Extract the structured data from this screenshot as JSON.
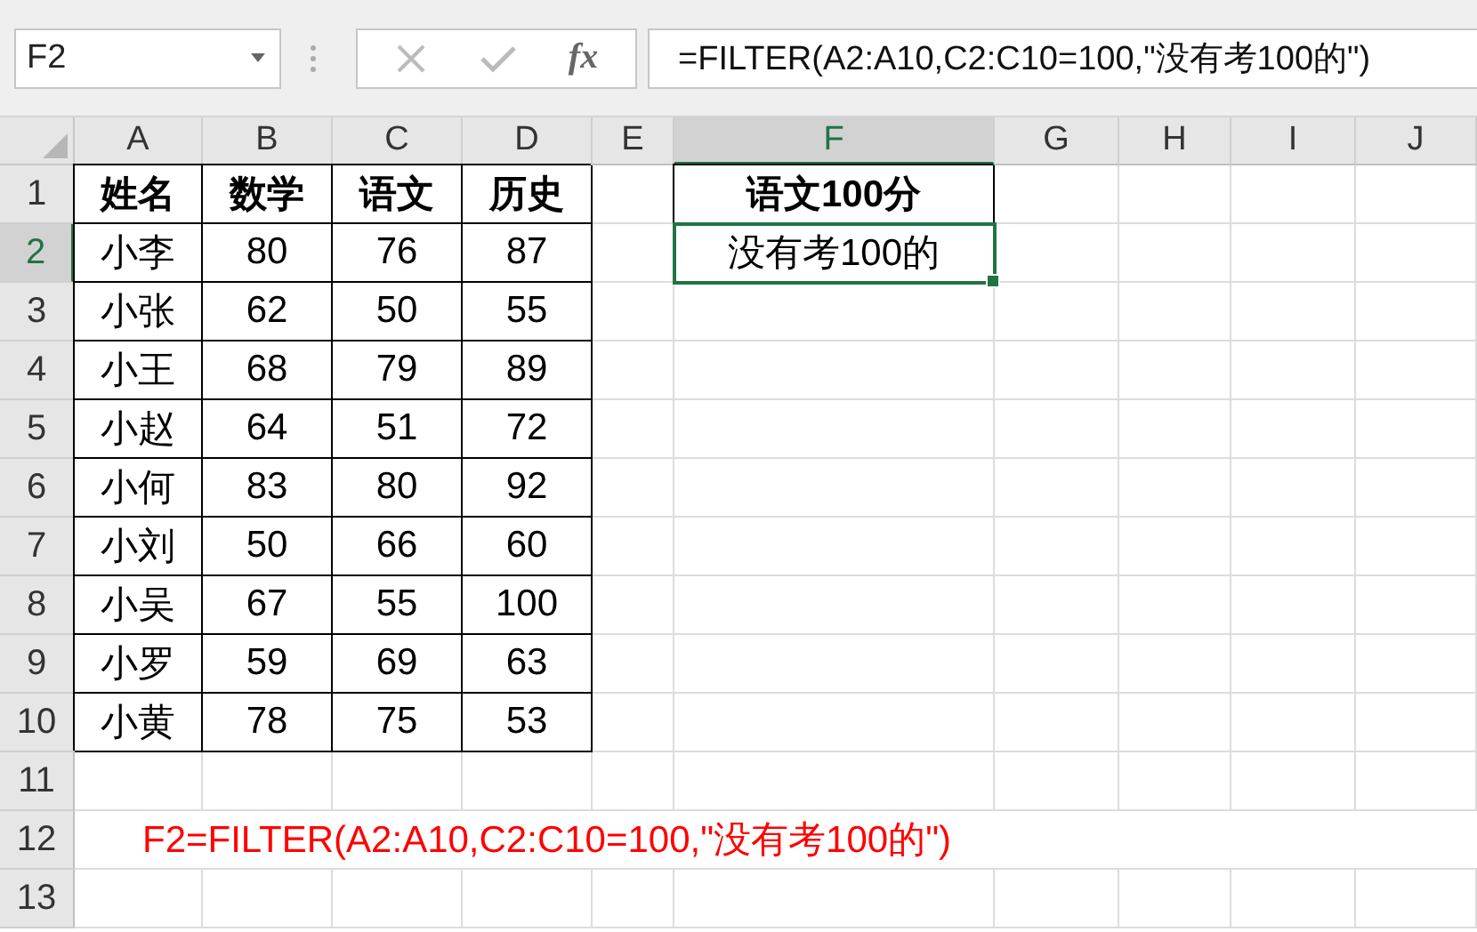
{
  "name_box": {
    "value": "F2"
  },
  "formula_bar": {
    "function_label": "fx",
    "value": "=FILTER(A2:A10,C2:C10=100,\"没有考100的\")"
  },
  "columns": [
    {
      "label": "A",
      "selected": false
    },
    {
      "label": "B",
      "selected": false
    },
    {
      "label": "C",
      "selected": false
    },
    {
      "label": "D",
      "selected": false
    },
    {
      "label": "E",
      "selected": false
    },
    {
      "label": "F",
      "selected": true
    },
    {
      "label": "G",
      "selected": false
    },
    {
      "label": "H",
      "selected": false
    },
    {
      "label": "I",
      "selected": false
    },
    {
      "label": "J",
      "selected": false
    }
  ],
  "row_headers": [
    {
      "label": "1",
      "selected": false
    },
    {
      "label": "2",
      "selected": true
    },
    {
      "label": "3",
      "selected": false
    },
    {
      "label": "4",
      "selected": false
    },
    {
      "label": "5",
      "selected": false
    },
    {
      "label": "6",
      "selected": false
    },
    {
      "label": "7",
      "selected": false
    },
    {
      "label": "8",
      "selected": false
    },
    {
      "label": "9",
      "selected": false
    },
    {
      "label": "10",
      "selected": false
    },
    {
      "label": "11",
      "selected": false
    },
    {
      "label": "12",
      "selected": false
    },
    {
      "label": "13",
      "selected": false
    }
  ],
  "score_table": {
    "header": [
      "姓名",
      "数学",
      "语文",
      "历史"
    ],
    "rows": [
      [
        "小李",
        "80",
        "76",
        "87"
      ],
      [
        "小张",
        "62",
        "50",
        "55"
      ],
      [
        "小王",
        "68",
        "79",
        "89"
      ],
      [
        "小赵",
        "64",
        "51",
        "72"
      ],
      [
        "小何",
        "83",
        "80",
        "92"
      ],
      [
        "小刘",
        "50",
        "66",
        "60"
      ],
      [
        "小吴",
        "67",
        "55",
        "100"
      ],
      [
        "小罗",
        "59",
        "69",
        "63"
      ],
      [
        "小黄",
        "78",
        "75",
        "53"
      ]
    ]
  },
  "result_column": {
    "header": "语文100分",
    "values": [
      {
        "text": "没有考100的",
        "selected": true
      }
    ]
  },
  "note": "F2=FILTER(A2:A10,C2:C10=100,\"没有考100的\")"
}
